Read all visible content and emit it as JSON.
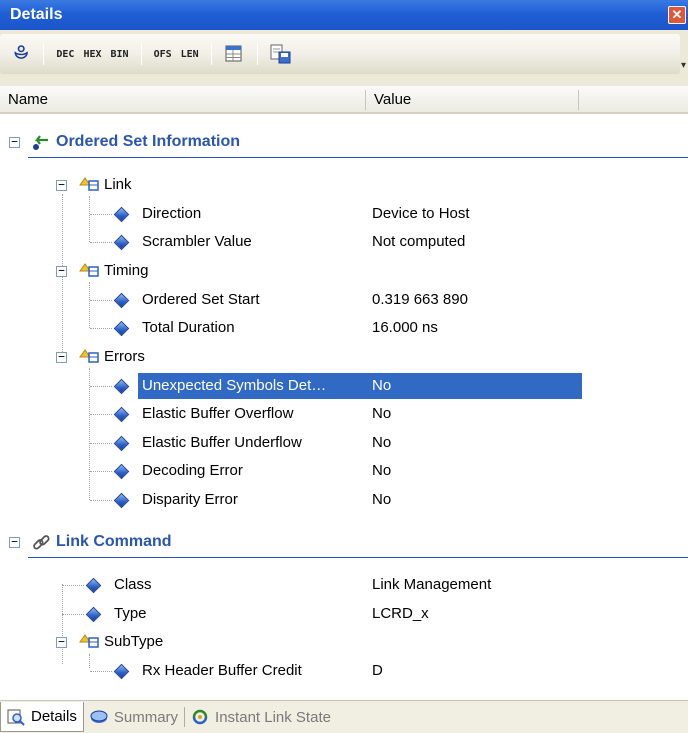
{
  "window": {
    "title": "Details",
    "close_label": "✕"
  },
  "toolbar": {
    "buttons": [
      "DEC",
      "HEX",
      "BIN",
      "OFS",
      "LEN"
    ]
  },
  "columns": {
    "name": "Name",
    "value": "Value"
  },
  "tree": {
    "sections": [
      {
        "title": "Ordered Set Information",
        "groups": [
          {
            "label": "Link",
            "fields": [
              {
                "name": "Direction",
                "value": "Device to Host"
              },
              {
                "name": "Scrambler Value",
                "value": "Not computed"
              }
            ]
          },
          {
            "label": "Timing",
            "fields": [
              {
                "name": "Ordered Set Start",
                "value": "0.319 663 890"
              },
              {
                "name": "Total Duration",
                "value": "16.000 ns"
              }
            ]
          },
          {
            "label": "Errors",
            "fields": [
              {
                "name": "Unexpected Symbols Det…",
                "value": "No",
                "selected": true
              },
              {
                "name": "Elastic Buffer Overflow",
                "value": "No"
              },
              {
                "name": "Elastic Buffer Underflow",
                "value": "No"
              },
              {
                "name": "Decoding Error",
                "value": "No"
              },
              {
                "name": "Disparity Error",
                "value": "No"
              }
            ]
          }
        ]
      },
      {
        "title": "Link Command",
        "fields": [
          {
            "name": "Class",
            "value": "Link Management"
          },
          {
            "name": "Type",
            "value": "LCRD_x"
          }
        ],
        "groups": [
          {
            "label": "SubType",
            "fields": [
              {
                "name": "Rx Header Buffer Credit",
                "value": "D"
              }
            ]
          }
        ]
      }
    ]
  },
  "tabs": [
    {
      "label": "Details",
      "active": true
    },
    {
      "label": "Summary",
      "active": false
    },
    {
      "label": "Instant Link State",
      "active": false
    }
  ],
  "colors": {
    "title_bar": "#1f5fd6",
    "section_title": "#2a55b0",
    "selection": "#316ac5"
  }
}
